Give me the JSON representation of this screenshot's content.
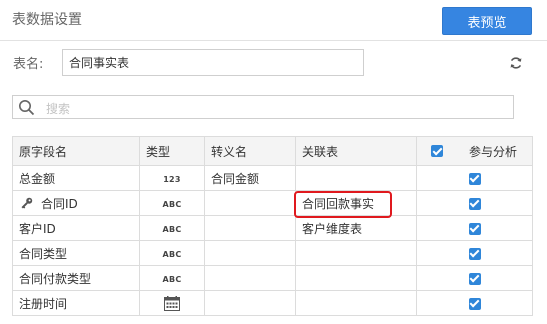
{
  "section_title": "表数据设置",
  "preview_button": "表预览",
  "table_name": {
    "label": "表名:",
    "value": "合同事实表"
  },
  "search": {
    "placeholder": "搜索"
  },
  "columns": {
    "original_name": "原字段名",
    "type": "类型",
    "alias": "转义名",
    "related_table": "关联表",
    "participate": "参与分析"
  },
  "rows": [
    {
      "name": "总金额",
      "type": "123",
      "alias": "合同金额",
      "related": "",
      "checked": true
    },
    {
      "name": "合同ID",
      "type": "ABC",
      "alias": "",
      "related": "合同回款事实",
      "checked": true,
      "key": true
    },
    {
      "name": "客户ID",
      "type": "ABC",
      "alias": "",
      "related": "客户维度表",
      "checked": true
    },
    {
      "name": "合同类型",
      "type": "ABC",
      "alias": "",
      "related": "",
      "checked": true
    },
    {
      "name": "合同付款类型",
      "type": "ABC",
      "alias": "",
      "related": "",
      "checked": true
    },
    {
      "name": "注册时间",
      "type": "calendar-icon",
      "alias": "",
      "related": "",
      "checked": true
    }
  ],
  "colors": {
    "accent": "#3685e1",
    "checkbox": "#2f86d9",
    "highlight": "#e0191e"
  }
}
